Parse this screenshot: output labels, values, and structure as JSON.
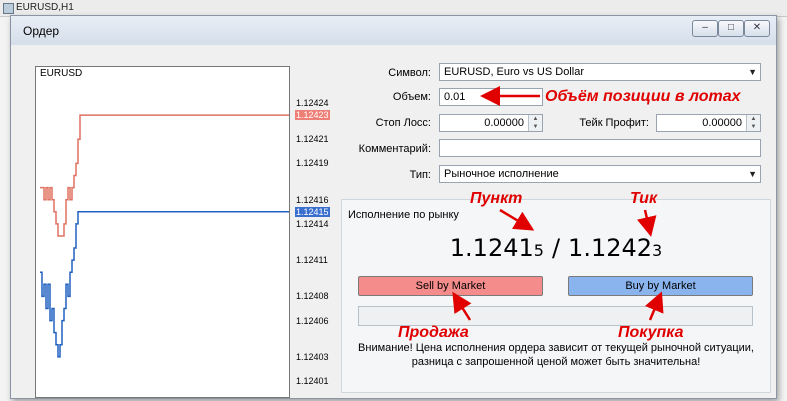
{
  "background_window": {
    "title": "EURUSD,H1"
  },
  "dialog": {
    "title": "Ордер",
    "controls": {
      "minimize": "‒",
      "maximize": "□",
      "close": "✕"
    }
  },
  "chart": {
    "symbol": "EURUSD",
    "price_labels": [
      "1.12424",
      "1.12423",
      "1.12421",
      "1.12419",
      "1.12416",
      "1.12415",
      "1.12414",
      "1.12411",
      "1.12408",
      "1.12406",
      "1.12403",
      "1.12401"
    ],
    "ask_label": "1.12423",
    "bid_label": "1.12415",
    "colors": {
      "ask": "#e07060",
      "bid": "#2060c0",
      "ask_badge": "#ee7f76",
      "bid_badge": "#3a6fd0"
    }
  },
  "form": {
    "symbol_label": "Символ:",
    "symbol_value": "EURUSD, Euro vs US Dollar",
    "volume_label": "Объем:",
    "volume_value": "0.01",
    "stoploss_label": "Стоп Лосс:",
    "stoploss_value": "0.00000",
    "takeprofit_label": "Тейк Профит:",
    "takeprofit_value": "0.00000",
    "comment_label": "Комментарий:",
    "comment_value": "",
    "type_label": "Тип:",
    "type_value": "Рыночное исполнение"
  },
  "execution": {
    "title": "Исполнение по рынку",
    "bid_main": "1.12415",
    "separator": "/",
    "ask_main": "1.12423",
    "sell_label": "Sell by Market",
    "buy_label": "Buy by Market",
    "warning_line1": "Внимание! Цена исполнения ордера зависит от текущей рыночной ситуации,",
    "warning_line2": "разница с запрошенной ценой может быть значительна!",
    "sell_color": "#f48c8c",
    "buy_color": "#8ab4ee"
  },
  "annotations": {
    "volume_note": "Объём позиции в лотах",
    "point_note": "Пункт",
    "tick_note": "Тик",
    "sell_note": "Продажа",
    "buy_note": "Покупка",
    "color": "#e00000"
  }
}
